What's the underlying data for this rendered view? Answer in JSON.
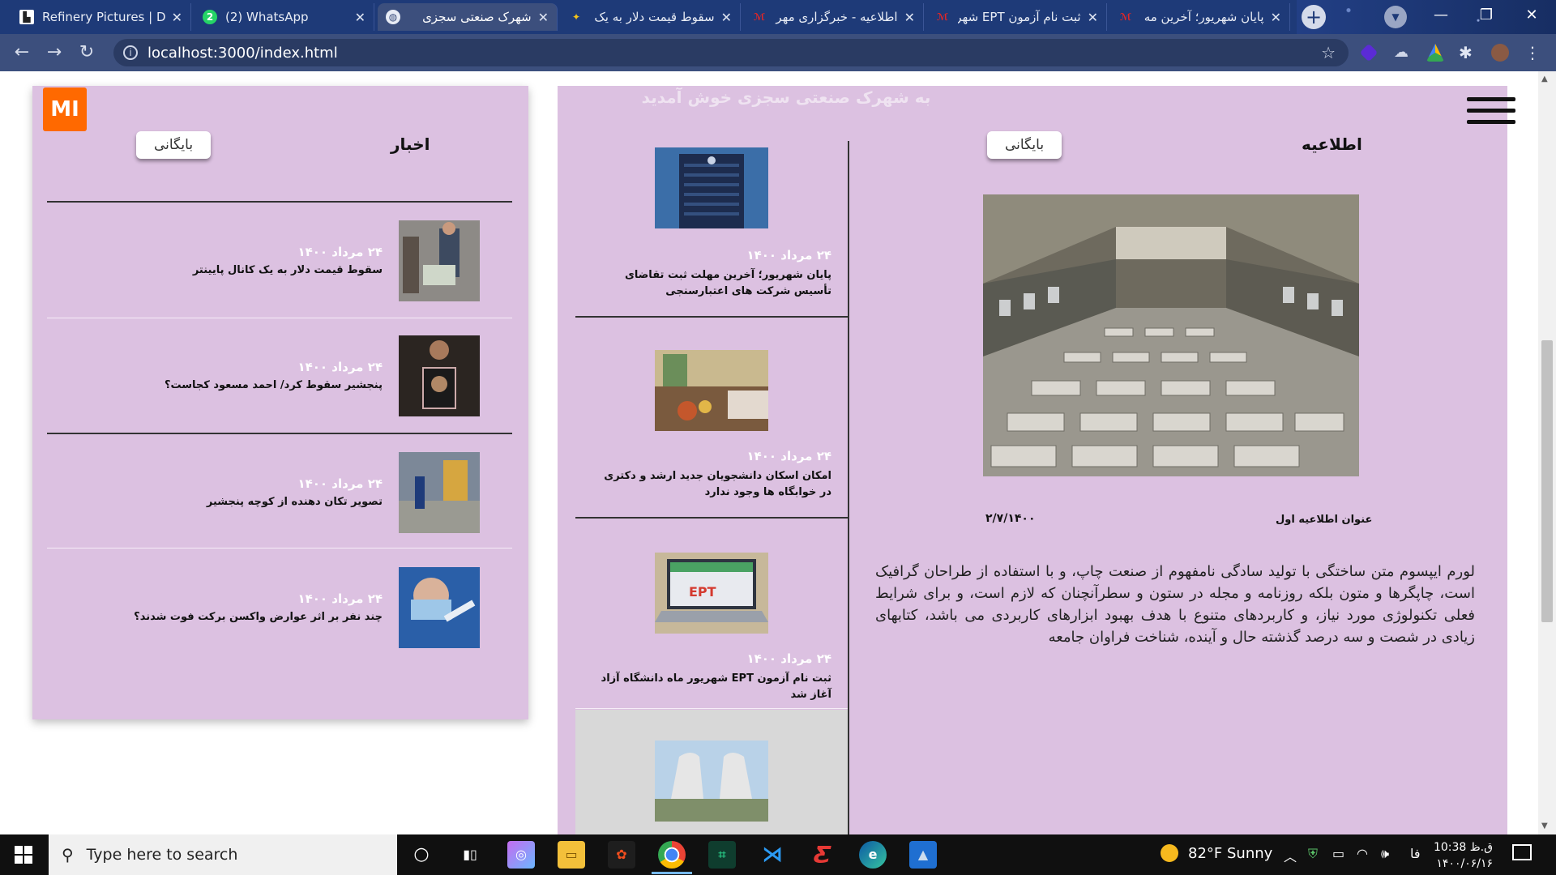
{
  "browser": {
    "tabs": [
      {
        "title": "Refinery Pictures | Dow",
        "icon": "refinery-favicon"
      },
      {
        "title": "(2) WhatsApp",
        "icon": "whatsapp-favicon"
      },
      {
        "title": "شهرک صنعتی سجزی",
        "icon": "globe-favicon",
        "active": true
      },
      {
        "title": "سقوط قیمت دلار به یک",
        "icon": "news-favicon"
      },
      {
        "title": "اطلاعیه - خبرگزاری مهر",
        "icon": "mehr-favicon"
      },
      {
        "title": "ثبت نام آزمون EPT شهر",
        "icon": "mehr-favicon"
      },
      {
        "title": "پایان شهریور؛ آخرین مه",
        "icon": "mehr-favicon"
      }
    ],
    "close_symbol": "✕",
    "new_tab_symbol": "+",
    "url": "localhost:3000/index.html"
  },
  "page": {
    "welcome": "به شهرک صنعتی سجزی خوش آمدید",
    "logo_text": "MI",
    "notices": {
      "title": "اطلاعیه",
      "archive_label": "بایگانی",
      "caption_title": "عنوان اطلاعیه اول",
      "caption_date": "۲/۷/۱۴۰۰",
      "body": "لورم ایپسوم متن ساختگی با تولید سادگی نامفهوم از صنعت چاپ، و با استفاده از طراحان گرافیک است، چاپگرها و متون بلکه روزنامه و مجله در ستون و سطرآنچنان که لازم است، و برای شرایط فعلی تکنولوژی مورد نیاز، و کاربردهای متنوع با هدف بهبود ابزارهای کاربردی می باشد، کتابهای زیادی در شصت و سه درصد گذشته حال و آینده، شناخت فراوان جامعه"
    },
    "middle_items": [
      {
        "date": "۲۴ مرداد ۱۴۰۰",
        "title": "پایان شهریور؛ آخرین مهلت ثبت تقاضای تأسیس شرکت های اعتبارسنجی"
      },
      {
        "date": "۲۴ مرداد ۱۴۰۰",
        "title": "امکان اسکان دانشجویان جدید ارشد و دکتری در خوابگاه ها وجود ندارد"
      },
      {
        "date": "۲۴ مرداد ۱۴۰۰",
        "title": "ثبت نام آزمون EPT شهریور ماه دانشگاه آزاد آغاز شد",
        "thumb_text": "EPT"
      },
      {
        "date": "",
        "title": ""
      }
    ],
    "news": {
      "title": "اخبار",
      "archive_label": "بایگانی",
      "items": [
        {
          "date": "۲۴ مرداد ۱۴۰۰",
          "title": "سقوط قیمت دلار به یک کانال پایینتر"
        },
        {
          "date": "۲۴ مرداد ۱۴۰۰",
          "title": "پنجشیر سقوط کرد/ احمد مسعود کجاست؟"
        },
        {
          "date": "۲۴ مرداد ۱۴۰۰",
          "title": "تصویر تکان دهنده از کوچه پنجشیر"
        },
        {
          "date": "۲۴ مرداد ۱۴۰۰",
          "title": "چند نفر بر اثر عوارض واکسن برکت فوت شدند؟"
        }
      ]
    }
  },
  "taskbar": {
    "search_placeholder": "Type here to search",
    "weather": "82°F  Sunny",
    "lang": "فا",
    "time": "10:38 ق.ظ",
    "date": "۱۴۰۰/۰۶/۱۶"
  },
  "colors": {
    "panel": "#dcc1e1",
    "tabbar": "#1e3a78",
    "toolbar": "#3c4f7d",
    "logo": "#ff6900"
  }
}
